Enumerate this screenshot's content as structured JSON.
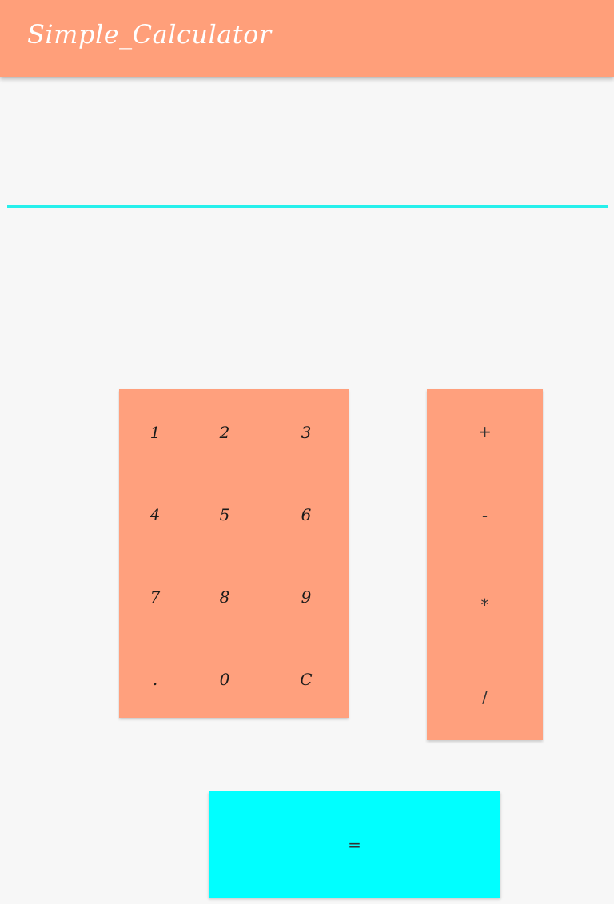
{
  "app_bar": {
    "title": "Simple_Calculator"
  },
  "display": {
    "value": "",
    "placeholder": ""
  },
  "keypad": {
    "keys": [
      "1",
      "2",
      "3",
      "4",
      "5",
      "6",
      "7",
      "8",
      "9",
      ".",
      "0",
      "C"
    ]
  },
  "operators": {
    "add": "+",
    "subtract": "-",
    "multiply": "*",
    "divide": "/"
  },
  "equals": {
    "label": "="
  },
  "colors": {
    "app_bar": "#ff9f7a",
    "keypad": "#ffa07d",
    "display_underline": "#26f0ec",
    "equals_button": "#00ffff",
    "background": "#f7f7f7"
  }
}
